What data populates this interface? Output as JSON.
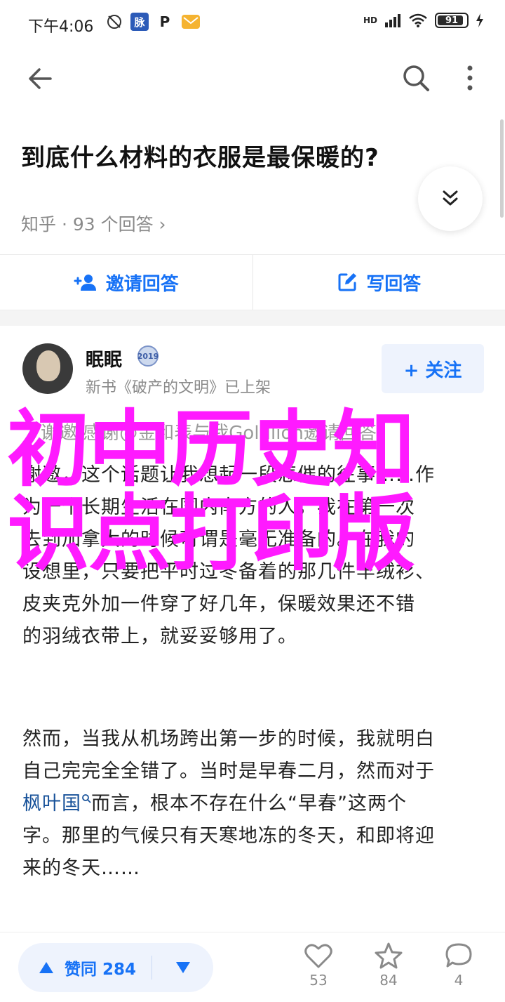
{
  "status_bar": {
    "time": "下午4:06",
    "box_label": "脉",
    "p_label": "P",
    "network": "HD",
    "battery": "91",
    "battery_level": 0.91
  },
  "question": {
    "title": "到底什么材料的衣服是最保暖的?",
    "meta": "知乎 · 93 个回答 ›"
  },
  "actions": {
    "invite_label": "邀请回答",
    "write_label": "写回答"
  },
  "author": {
    "name": "眠眠",
    "badge": "2019",
    "desc": "新书《破产的文明》已上架",
    "follow_label": "+ 关注"
  },
  "answer": {
    "invite_line": "谢邀 感谢@金和表与我Goldlion邀请回答",
    "para1_lines": [
      "谢邀，这个话题让我想起一段悲催的往事……作",
      "为一个长期生活在国内南方的人，我在第一次",
      "去到加拿大的时候可谓是毫无准备的。在我的",
      "设想里，只要把平时过冬备着的那几件羊绒衫、",
      "皮夹克外加一件穿了好几年，保暖效果还不错",
      "的羽绒衣带上，就妥妥够用了。"
    ],
    "para2_lines": [
      "然而，当我从机场跨出第一步的时候，我就明白",
      "自己完完全全错了。当时是早春二月，然而对于"
    ],
    "para2_link": "枫叶国",
    "para2_link_rest": "而言，根本不存在什么“早春”这两个",
    "para2_tail": [
      "字。那里的气候只有天寒地冻的冬天，和即将迎",
      "来的冬天……"
    ]
  },
  "overlay": {
    "line1": "初中历史知",
    "line2": "识点打印版"
  },
  "bottom_bar": {
    "upvote_label": "赞同 284",
    "like_count": "53",
    "star_count": "84",
    "comment_count": "4"
  },
  "colors": {
    "accent": "#1772f6",
    "overlay": "#ff1aff"
  }
}
